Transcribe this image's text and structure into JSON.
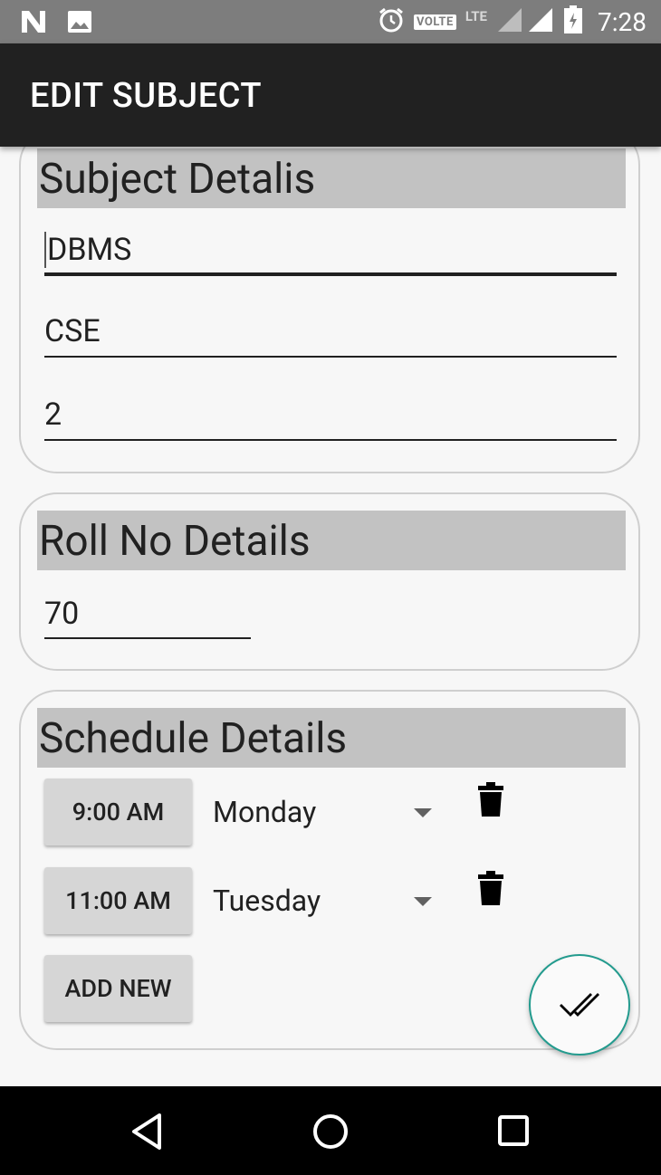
{
  "status_bar": {
    "volte": "VOLTE",
    "lte": "LTE",
    "time": "7:28"
  },
  "app_bar": {
    "title": "EDIT SUBJECT"
  },
  "subject_card": {
    "header": "Subject Detalis",
    "fields": [
      {
        "value": "DBMS"
      },
      {
        "value": "CSE"
      },
      {
        "value": "2"
      }
    ]
  },
  "roll_card": {
    "header": "Roll No Details",
    "roll_no": "70"
  },
  "schedule_card": {
    "header": "Schedule Details",
    "rows": [
      {
        "time": "9:00 AM",
        "day": "Monday"
      },
      {
        "time": "11:00 AM",
        "day": "Tuesday"
      }
    ],
    "add_new_label": "ADD NEW"
  },
  "colors": {
    "status_bar": "#7d7d7d",
    "app_bar": "#212121",
    "card_header": "#c2c2c2",
    "fab_border": "#239b8e"
  },
  "icons": [
    "n-icon",
    "image-icon",
    "alarm-icon",
    "signal-icon",
    "battery-icon",
    "delete-icon",
    "done-all-icon",
    "back-icon",
    "home-icon",
    "recents-icon"
  ]
}
